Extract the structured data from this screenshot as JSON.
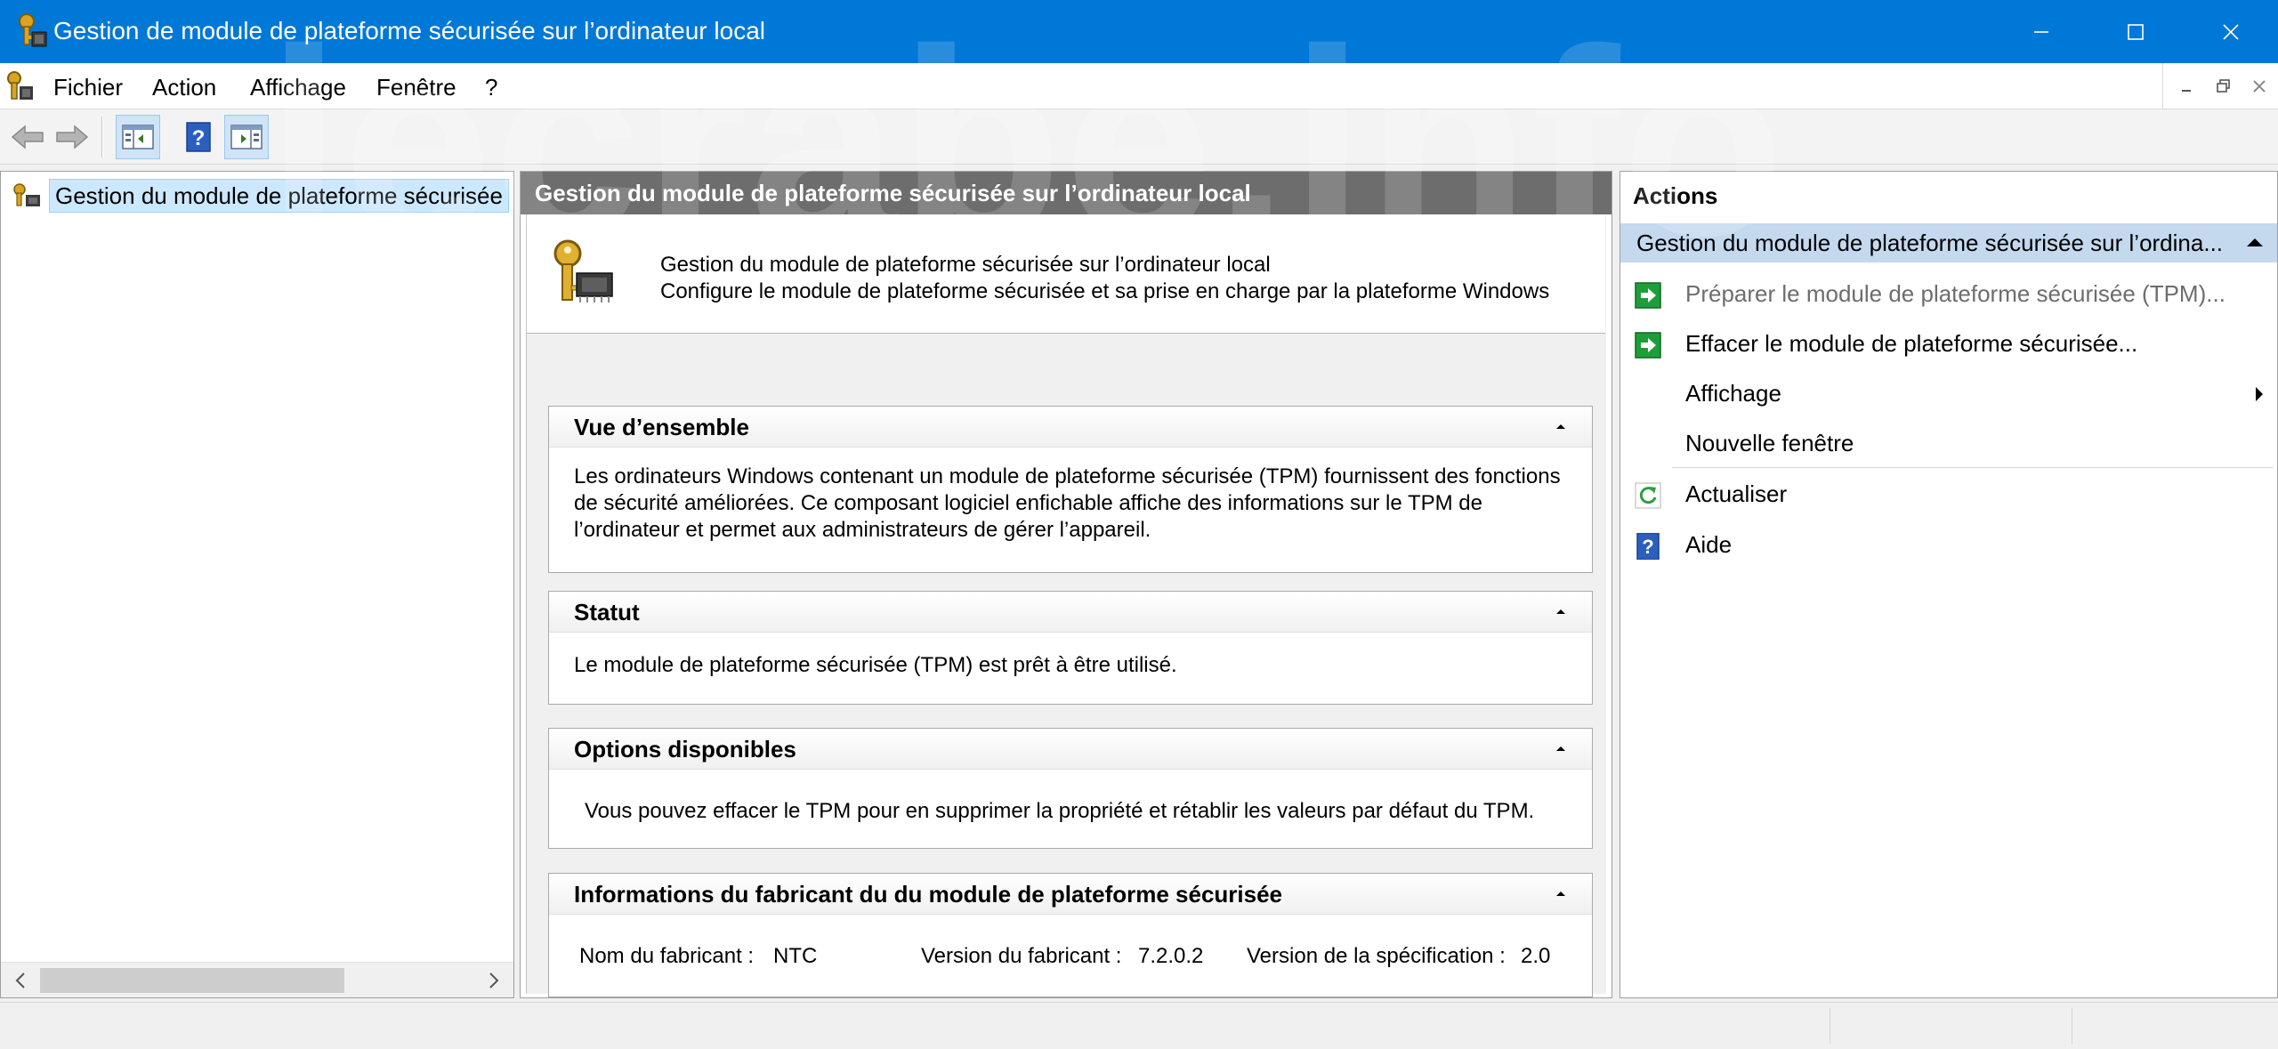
{
  "window": {
    "title": "Gestion de module de plateforme sécurisée sur l’ordinateur local",
    "controls": [
      "minimize-icon",
      "maximize-icon",
      "close-icon"
    ]
  },
  "menubar": {
    "items": [
      "Fichier",
      "Action",
      "Affichage",
      "Fenêtre",
      "?"
    ]
  },
  "toolbar": {
    "buttons": [
      "back-arrow-icon",
      "forward-arrow-icon",
      "show-hide-console-tree-icon",
      "help-icon",
      "show-hide-action-pane-icon"
    ]
  },
  "tree": {
    "root_label": "Gestion du module de plateforme sécurisée"
  },
  "center": {
    "header": "Gestion du module de plateforme sécurisée sur l’ordinateur local",
    "intro_line1": "Gestion du module de plateforme sécurisée sur l’ordinateur local",
    "intro_line2": "Configure le module de plateforme sécurisée et sa prise en charge par la plateforme Windows",
    "sections": [
      {
        "title": "Vue d’ensemble",
        "text": "Les ordinateurs Windows contenant un module de plateforme sécurisée (TPM) fournissent des fonctions de sécurité améliorées. Ce composant logiciel enfichable affiche des informations sur le TPM de l’ordinateur et permet aux administrateurs de gérer l’appareil."
      },
      {
        "title": "Statut",
        "text": "Le module de plateforme sécurisée (TPM) est prêt à être utilisé."
      },
      {
        "title": "Options disponibles",
        "text": "Vous pouvez effacer le TPM pour en supprimer la propriété et rétablir les valeurs par défaut du TPM."
      },
      {
        "title": "Informations du fabricant du du module de plateforme sécurisée",
        "manufacturer_name_label": "Nom du fabricant :",
        "manufacturer_name_value": "NTC",
        "manufacturer_version_label": "Version du fabricant :",
        "manufacturer_version_value": "7.2.0.2",
        "spec_version_label": "Version de la spécification :",
        "spec_version_value": "2.0"
      }
    ]
  },
  "actions": {
    "title": "Actions",
    "group_label": "Gestion du module de plateforme sécurisée sur l’ordina...",
    "items": [
      {
        "label": "Préparer le module de plateforme sécurisée (TPM)...",
        "icon": "green-arrow-icon",
        "enabled": false
      },
      {
        "label": "Effacer le module de plateforme sécurisée...",
        "icon": "green-arrow-icon",
        "enabled": true
      },
      {
        "label": "Affichage",
        "icon": "",
        "enabled": true,
        "submenu": true
      },
      {
        "label": "Nouvelle fenêtre",
        "icon": "",
        "enabled": true
      },
      {
        "label": "Actualiser",
        "icon": "refresh-icon",
        "enabled": true
      },
      {
        "label": "Aide",
        "icon": "help-icon",
        "enabled": true
      }
    ]
  },
  "watermark": "lecrabe.info",
  "colors": {
    "titlebar": "#0078d7",
    "center_header": "#6d6d6d",
    "selection": "#cce8ff",
    "actions_group": "#c4d9ee",
    "action_arrow": "#1e9e3a"
  }
}
